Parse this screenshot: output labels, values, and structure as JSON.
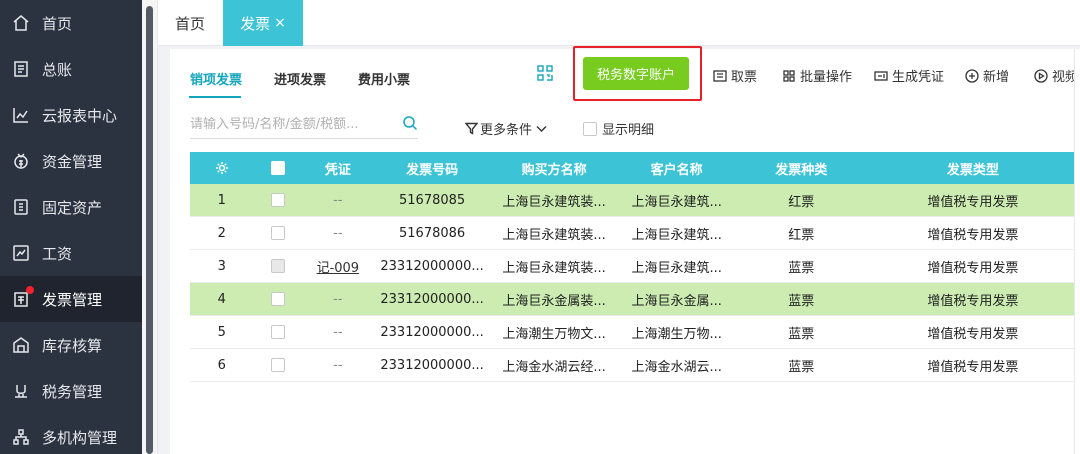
{
  "sidebar": {
    "items": [
      {
        "label": "首页",
        "icon": "home-icon"
      },
      {
        "label": "总账",
        "icon": "ledger-icon"
      },
      {
        "label": "云报表中心",
        "icon": "report-chart-icon"
      },
      {
        "label": "资金管理",
        "icon": "money-icon"
      },
      {
        "label": "固定资产",
        "icon": "asset-icon"
      },
      {
        "label": "工资",
        "icon": "salary-icon"
      },
      {
        "label": "发票管理",
        "icon": "invoice-icon",
        "active": true
      },
      {
        "label": "库存核算",
        "icon": "warehouse-icon"
      },
      {
        "label": "税务管理",
        "icon": "tax-icon"
      },
      {
        "label": "多机构管理",
        "icon": "org-tree-icon"
      }
    ]
  },
  "tabs": {
    "home": "首页",
    "invoice": "发票",
    "close": "×"
  },
  "subtabs": [
    "销项发票",
    "进项发票",
    "费用小票"
  ],
  "toolbar": {
    "tax_account": "税务数字账户",
    "fetch": "取票",
    "batch": "批量操作",
    "voucher": "生成凭证",
    "add": "新增",
    "video": "视频"
  },
  "filters": {
    "search_placeholder": "请输入号码/名称/金额/税额...",
    "more_conditions": "更多条件",
    "show_detail": "显示明细"
  },
  "table": {
    "headers": [
      "凭证",
      "发票号码",
      "购买方名称",
      "客户名称",
      "发票种类",
      "发票类型"
    ],
    "rows": [
      {
        "no": "1",
        "voucher": "--",
        "invoice_no": "51678085",
        "buyer": "上海巨永建筑装...",
        "customer": "上海巨永建筑...",
        "kind": "红票",
        "type": "增值税专用发票",
        "highlight": true
      },
      {
        "no": "2",
        "voucher": "--",
        "invoice_no": "51678086",
        "buyer": "上海巨永建筑装...",
        "customer": "上海巨永建筑...",
        "kind": "红票",
        "type": "增值税专用发票",
        "highlight": false
      },
      {
        "no": "3",
        "voucher": "记-009",
        "invoice_no": "23312000000...",
        "buyer": "上海巨永建筑装...",
        "customer": "上海巨永建筑...",
        "kind": "蓝票",
        "type": "增值税专用发票",
        "highlight": false
      },
      {
        "no": "4",
        "voucher": "--",
        "invoice_no": "23312000000...",
        "buyer": "上海巨永金属装...",
        "customer": "上海巨永金属...",
        "kind": "蓝票",
        "type": "增值税专用发票",
        "highlight": true
      },
      {
        "no": "5",
        "voucher": "--",
        "invoice_no": "23312000000...",
        "buyer": "上海潮生万物文...",
        "customer": "上海潮生万物...",
        "kind": "蓝票",
        "type": "增值税专用发票",
        "highlight": false
      },
      {
        "no": "6",
        "voucher": "--",
        "invoice_no": "23312000000...",
        "buyer": "上海金水湖云经...",
        "customer": "上海金水湖云...",
        "kind": "蓝票",
        "type": "增值税专用发票",
        "highlight": false
      }
    ]
  },
  "colors": {
    "accent": "#3cc3d6",
    "primary_button": "#77cc1f",
    "highlight_row": "#ccecb1",
    "callout_border": "#e8202a",
    "sidebar_bg": "#2b3240"
  }
}
